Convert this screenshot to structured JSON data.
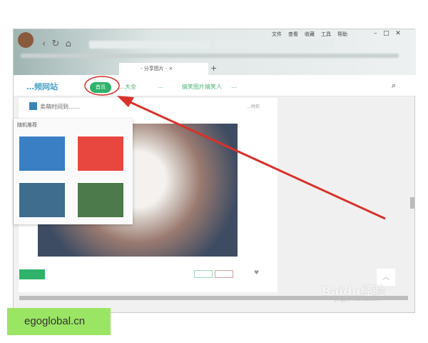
{
  "browser": {
    "menu": [
      "文件",
      "查看",
      "收藏",
      "工具",
      "帮助"
    ],
    "window_controls": [
      "minimize",
      "maximize",
      "close"
    ],
    "tab_title": "- 分享图片 ·",
    "new_tab": "+"
  },
  "site": {
    "logo": "…频网站",
    "nav": [
      {
        "label": "首页",
        "active": true
      },
      {
        "label": "…大全"
      },
      {
        "label": "…"
      },
      {
        "label": "搞笑图片搞笑人"
      },
      {
        "label": "…"
      }
    ],
    "search_icon": "search-icon"
  },
  "post": {
    "title": "卖萌时间到……",
    "time": "…时前"
  },
  "popup": {
    "title": "随机推荐",
    "thumbs": [
      "#3a7fc4",
      "#e8473f",
      "#3e6d8e",
      "#4d7a4a"
    ]
  },
  "watermark": {
    "brand": "Baidu经验",
    "url": "jingyan.baidu.com"
  },
  "footer_label": "egoglobal.cn",
  "colors": {
    "accent": "#2fb36b",
    "annotation": "#d9312b"
  }
}
